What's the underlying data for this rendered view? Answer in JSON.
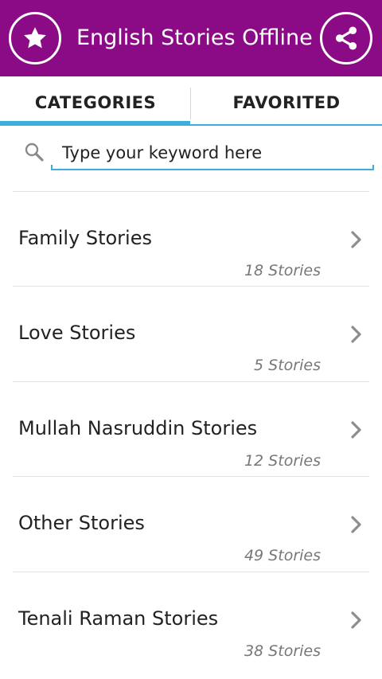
{
  "app_bar": {
    "title": "English Stories Offline",
    "left_icon": "star-icon",
    "right_icon": "share-icon",
    "color": "#8b0b86"
  },
  "tabs": [
    {
      "label": "CATEGORIES",
      "selected": true
    },
    {
      "label": "FAVORITED",
      "selected": false
    }
  ],
  "accent_color": "#3eadd8",
  "search": {
    "placeholder": "Type your keyword here",
    "value": "",
    "icon": "search-icon"
  },
  "categories": [
    {
      "name": "Family Stories",
      "count": "18 Stories",
      "icon": "chevron-right-icon"
    },
    {
      "name": "Love Stories",
      "count": "5 Stories",
      "icon": "chevron-right-icon"
    },
    {
      "name": "Mullah Nasruddin Stories",
      "count": "12 Stories",
      "icon": "chevron-right-icon"
    },
    {
      "name": "Other Stories",
      "count": "49 Stories",
      "icon": "chevron-right-icon"
    },
    {
      "name": "Tenali Raman Stories",
      "count": "38 Stories",
      "icon": "chevron-right-icon"
    }
  ]
}
